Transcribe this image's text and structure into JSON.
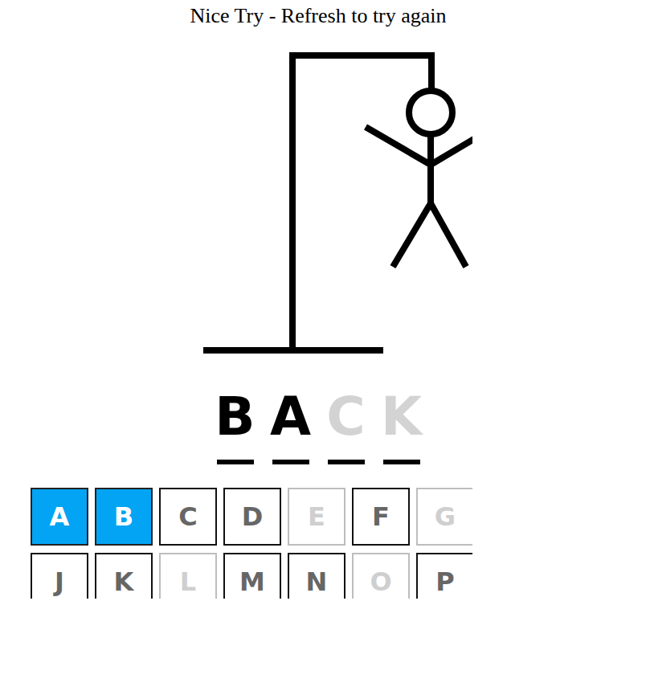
{
  "title": "Nice Try - Refresh to try again",
  "hangman": {
    "parts": [
      {
        "name": "head",
        "shown": true
      },
      {
        "name": "body",
        "shown": true
      },
      {
        "name": "left-arm",
        "shown": true
      },
      {
        "name": "right-arm",
        "shown": true
      },
      {
        "name": "left-leg",
        "shown": true
      },
      {
        "name": "right-leg",
        "shown": true
      }
    ]
  },
  "word": [
    {
      "letter": "B",
      "revealed": true
    },
    {
      "letter": "A",
      "revealed": true
    },
    {
      "letter": "C",
      "revealed": false
    },
    {
      "letter": "K",
      "revealed": false
    }
  ],
  "keyboard": [
    [
      {
        "key": "A",
        "guessed": true,
        "correct": true
      },
      {
        "key": "B",
        "guessed": true,
        "correct": true
      },
      {
        "key": "C",
        "guessed": false,
        "correct": false
      },
      {
        "key": "D",
        "guessed": false,
        "correct": false
      },
      {
        "key": "E",
        "guessed": true,
        "correct": false
      },
      {
        "key": "F",
        "guessed": false,
        "correct": false
      },
      {
        "key": "G",
        "guessed": true,
        "correct": false
      }
    ],
    [
      {
        "key": "J",
        "guessed": false,
        "correct": false
      },
      {
        "key": "K",
        "guessed": false,
        "correct": false
      },
      {
        "key": "L",
        "guessed": true,
        "correct": false
      },
      {
        "key": "M",
        "guessed": false,
        "correct": false
      },
      {
        "key": "N",
        "guessed": false,
        "correct": false
      },
      {
        "key": "O",
        "guessed": true,
        "correct": false
      },
      {
        "key": "P",
        "guessed": false,
        "correct": false
      }
    ]
  ]
}
